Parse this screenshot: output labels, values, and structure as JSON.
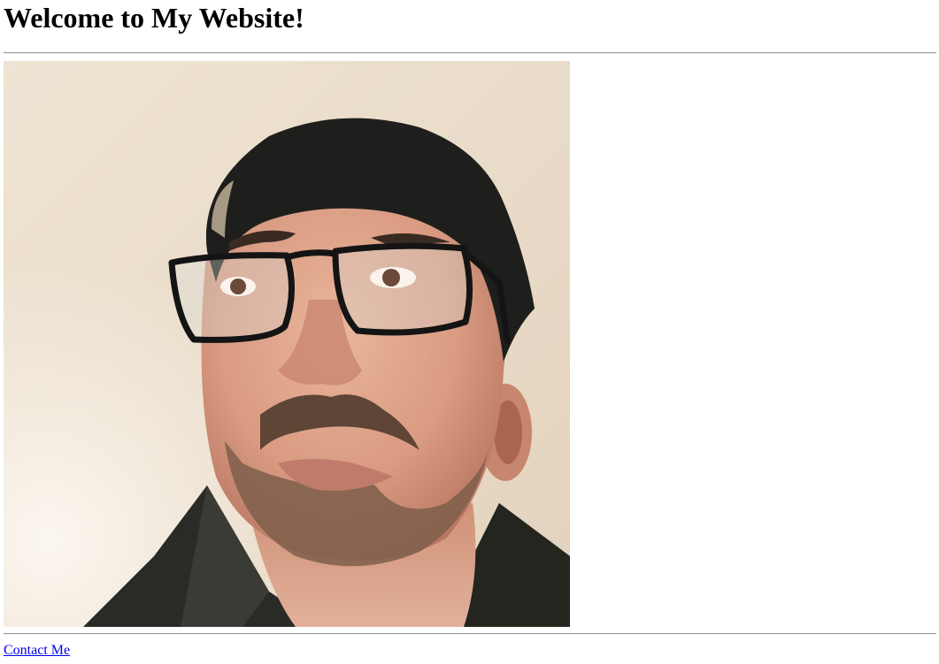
{
  "page": {
    "heading": "Welcome to My Website!",
    "portrait_description_icon": "portrait-illustration",
    "contact_link": "Contact Me"
  },
  "colors": {
    "link": "#0000ee",
    "rule": "#9a9a9a",
    "background": "#ffffff"
  }
}
